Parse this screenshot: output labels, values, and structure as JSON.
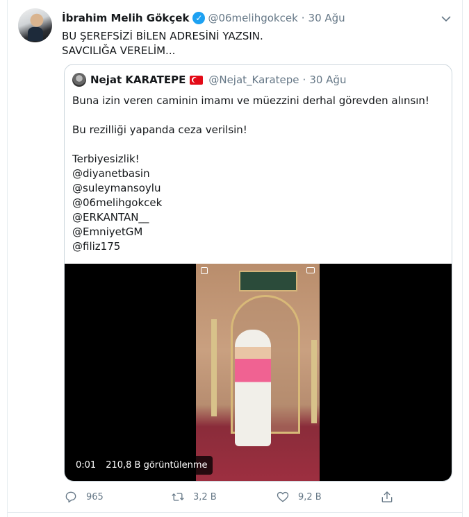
{
  "tweet": {
    "author_name": "İbrahim Melih Gökçek",
    "handle": "@06melihgokcek",
    "separator": "·",
    "date": "30 Ağu",
    "text_lines": [
      "BU ŞEREFSİZİ BİLEN ADRESİNİ YAZSIN.",
      "SAVCILIĞA VERELİM..."
    ]
  },
  "quote": {
    "author_name": "Nejat KARATEPE",
    "handle": "@Nejat_Karatepe",
    "separator": "·",
    "date": "30 Ağu",
    "text": {
      "p1": "Buna izin veren caminin imamı ve müezzini derhal görevden alınsın!",
      "p2": "Bu rezilliği yapanda ceza verilsin!",
      "p3_lines": [
        "Terbiyesizlik!",
        "@diyanetbasin",
        "@suleymansoylu",
        "@06melihgokcek",
        "@ERKANTAN__",
        "@EmniyetGM",
        "@filiz175"
      ]
    },
    "video": {
      "time": "0:01",
      "views": "210,8 B görüntülenme"
    }
  },
  "actions": {
    "reply_count": "965",
    "retweet_count": "3,2 B",
    "like_count": "9,2 B"
  },
  "colors": {
    "accent": "#1da1f2",
    "secondary_text": "#657786",
    "border": "#ccd6dd"
  },
  "icons": [
    "verified-badge-icon",
    "chevron-down-icon",
    "turkey-flag-icon",
    "reply-icon",
    "retweet-icon",
    "like-icon",
    "share-icon"
  ]
}
